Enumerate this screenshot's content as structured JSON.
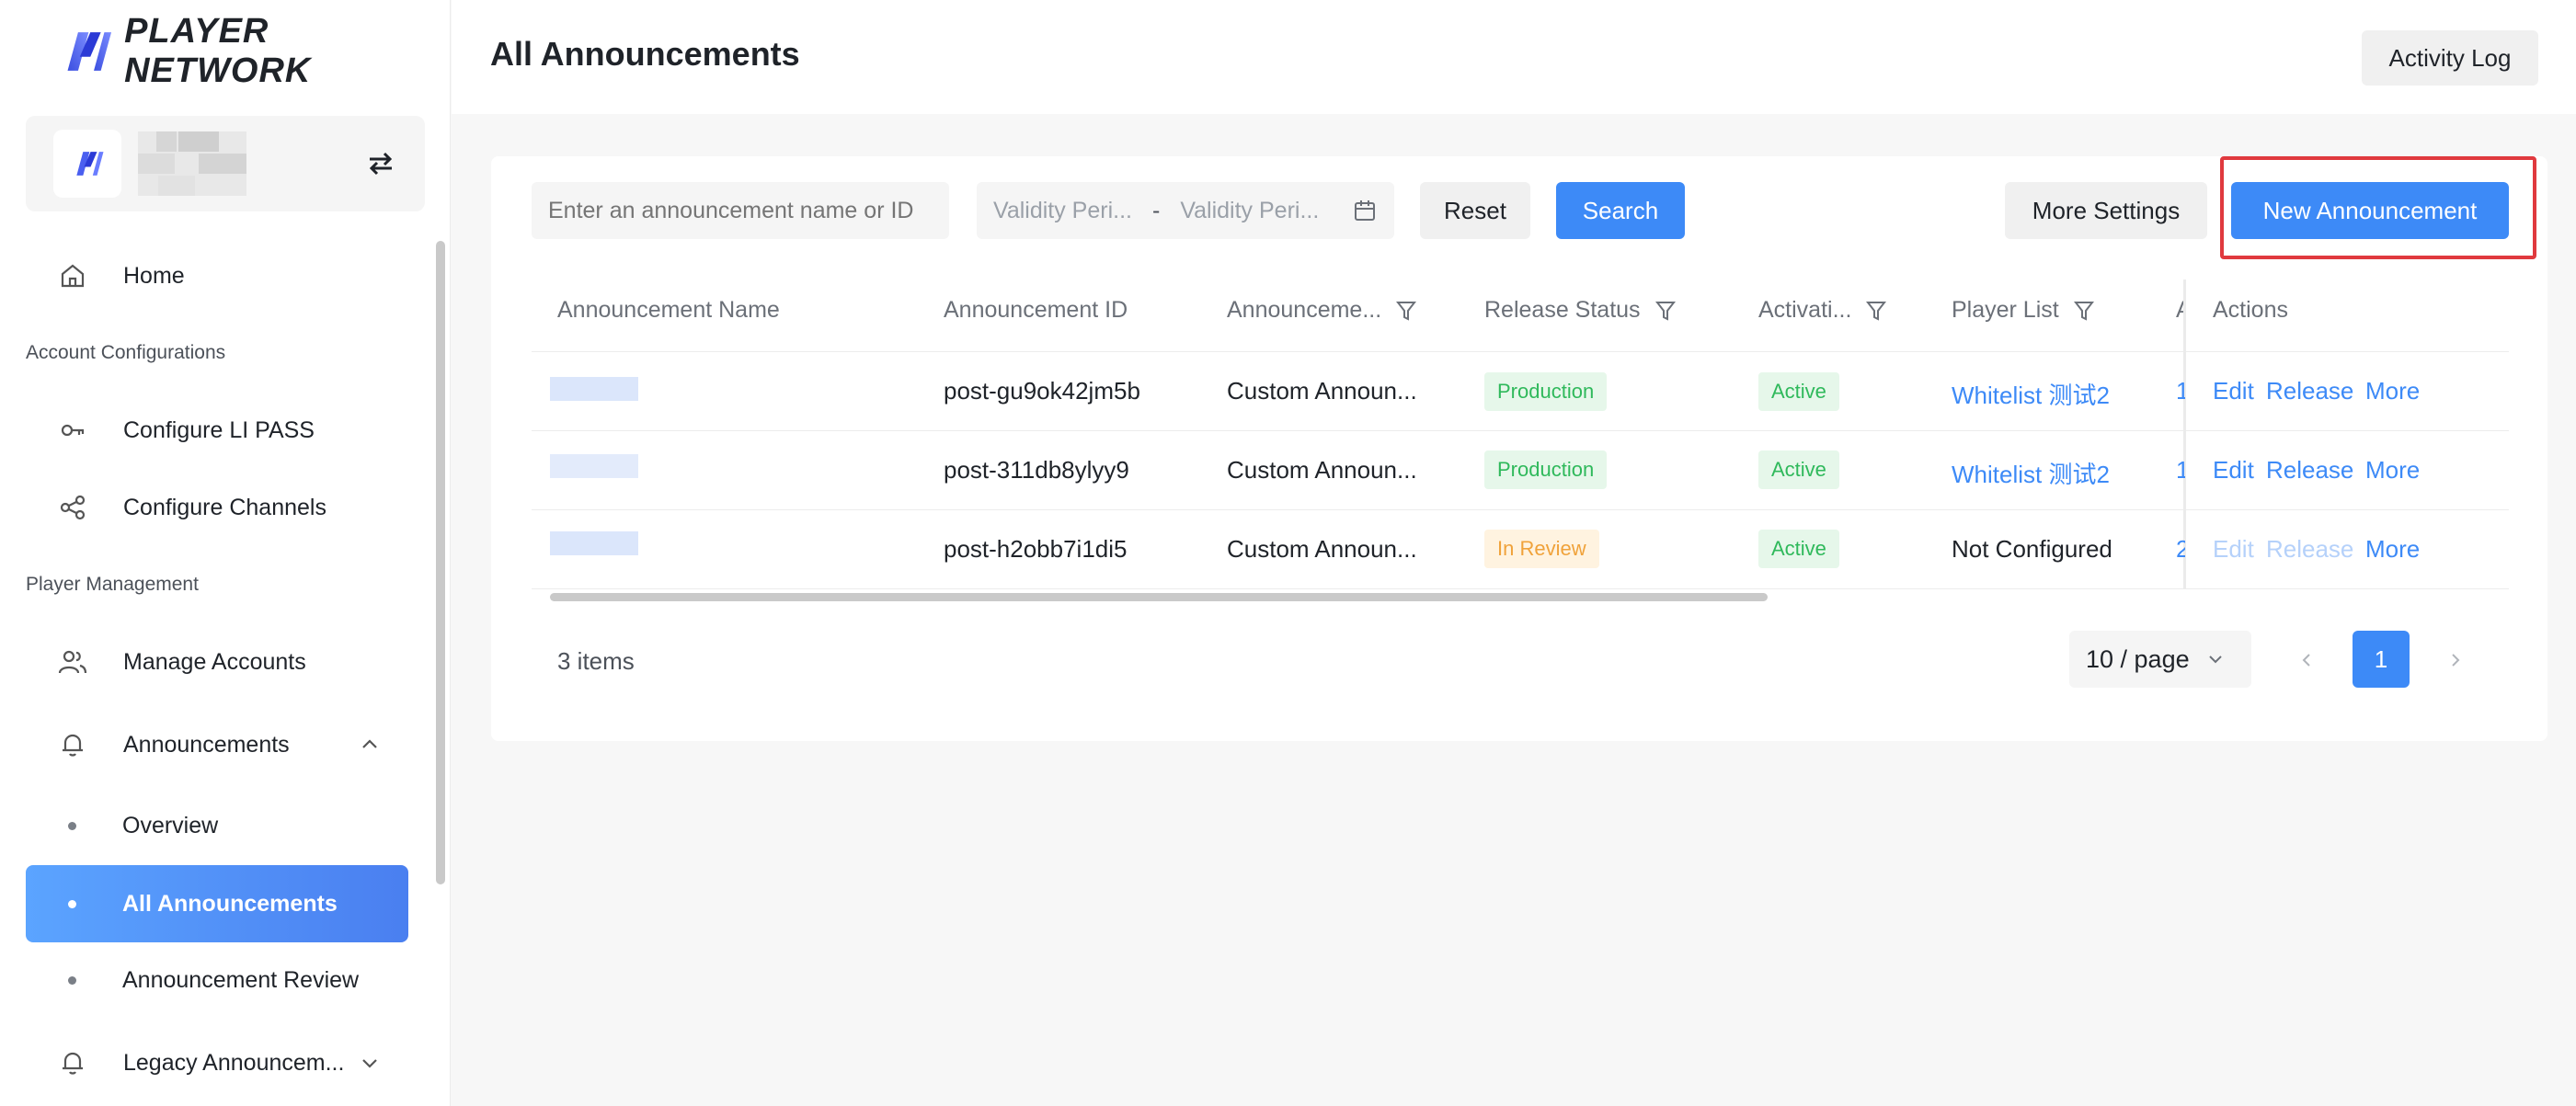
{
  "brand": {
    "name": "PLAYER NETWORK"
  },
  "sidebar": {
    "sections": {
      "account": "Account Configurations",
      "player": "Player Management"
    },
    "items": {
      "home": "Home",
      "configure_lipass": "Configure LI PASS",
      "configure_channels": "Configure Channels",
      "manage_accounts": "Manage Accounts",
      "announcements": "Announcements",
      "overview": "Overview",
      "all_announcements": "All Announcements",
      "announcement_review": "Announcement Review",
      "legacy": "Legacy Announcem..."
    }
  },
  "header": {
    "title": "All Announcements",
    "activity_log": "Activity Log"
  },
  "toolbar": {
    "search_placeholder": "Enter an announcement name or ID",
    "date_start": "Validity Peri...",
    "date_sep": "-",
    "date_end": "Validity Peri...",
    "reset": "Reset",
    "search": "Search",
    "more_settings": "More Settings",
    "new_announcement": "New Announcement"
  },
  "table": {
    "columns": {
      "name": "Announcement Name",
      "id": "Announcement ID",
      "type": "Announceme...",
      "release_status": "Release Status",
      "activation": "Activati...",
      "player_list": "Player List",
      "hidden_col": "A",
      "actions": "Actions"
    },
    "rows": [
      {
        "id": "post-gu9ok42jm5b",
        "type": "Custom Announ...",
        "release_status": "Production",
        "activation": "Active",
        "player_list": "Whitelist 测试2",
        "hidden_col": "1",
        "edit": "Edit",
        "release": "Release",
        "more": "More"
      },
      {
        "id": "post-311db8ylyy9",
        "type": "Custom Announ...",
        "release_status": "Production",
        "activation": "Active",
        "player_list": "Whitelist 测试2",
        "hidden_col": "1",
        "edit": "Edit",
        "release": "Release",
        "more": "More"
      },
      {
        "id": "post-h2obb7i1di5",
        "type": "Custom Announ...",
        "release_status": "In Review",
        "activation": "Active",
        "player_list": "Not Configured",
        "hidden_col": "2",
        "edit": "Edit",
        "release": "Release",
        "more": "More"
      }
    ]
  },
  "pagination": {
    "total": "3 items",
    "page_size": "10 / page",
    "current_page": "1"
  },
  "colors": {
    "primary": "#3d8af7",
    "highlight": "#e0393e",
    "success": "#2fb95b",
    "warning": "#f0a23a"
  }
}
